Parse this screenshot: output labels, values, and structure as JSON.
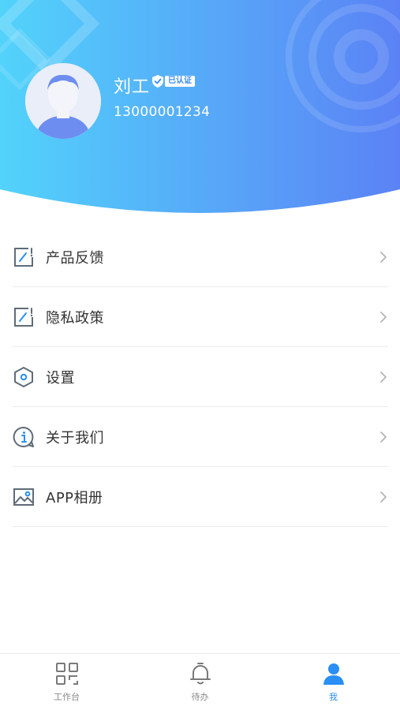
{
  "profile": {
    "name": "刘工",
    "verified_label": "已认证",
    "phone": "13000001234"
  },
  "menu": [
    {
      "label": "产品反馈",
      "icon": "feedback-edit-icon"
    },
    {
      "label": "隐私政策",
      "icon": "privacy-edit-icon"
    },
    {
      "label": "设置",
      "icon": "settings-hexagon-icon"
    },
    {
      "label": "关于我们",
      "icon": "info-icon"
    },
    {
      "label": "APP相册",
      "icon": "image-album-icon"
    }
  ],
  "tabbar": {
    "tabs": [
      {
        "label": "工作台",
        "icon": "grid-workbench-icon",
        "active": false
      },
      {
        "label": "待办",
        "icon": "bell-icon",
        "active": false
      },
      {
        "label": "我",
        "icon": "person-icon",
        "active": true
      }
    ]
  },
  "colors": {
    "header_gradient_start": "#52d3fb",
    "header_gradient_end": "#5b82f5",
    "accent": "#2a8ef4",
    "icon_gray": "#5f6b78"
  }
}
